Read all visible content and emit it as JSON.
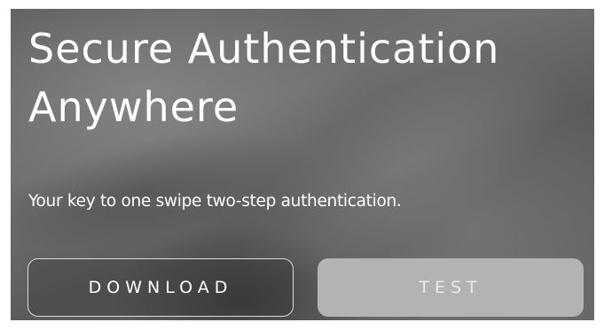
{
  "hero": {
    "title": "Secure Authentication Anywhere",
    "subtitle": "Your key to one swipe two-step authentication."
  },
  "buttons": {
    "download_label": "DOWNLOAD",
    "test_label": "TEST"
  },
  "colors": {
    "background": "#666666",
    "test_button_fill": "#b3b3b3",
    "download_button_border": "#dcdcdc",
    "text": "#ffffff"
  }
}
